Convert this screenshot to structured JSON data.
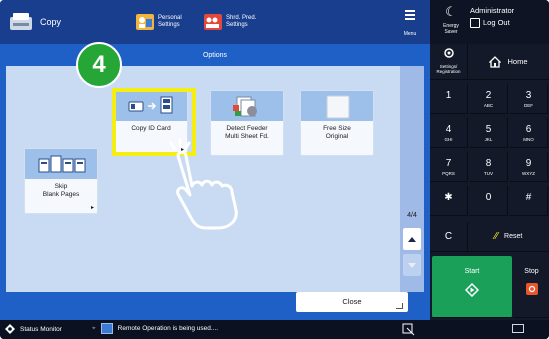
{
  "header": {
    "app_title": "Copy",
    "personal_settings": [
      "Personal",
      "Settings"
    ],
    "shared_settings": [
      "Shrd. Pred.",
      "Settings"
    ],
    "menu_label": "Menu",
    "energy_saver_label": "Energy Saver",
    "user_name": "Administrator",
    "logout_label": "Log Out"
  },
  "options_panel": {
    "title": "Options",
    "page_indicator": "4/4",
    "close_label": "Close",
    "items": [
      {
        "label": "Copy ID Card",
        "label2": "",
        "has_arrow": true,
        "icon": "id-card-copy-icon"
      },
      {
        "label": "Detect Feeder",
        "label2": "Multi Sheet Fd.",
        "has_arrow": false,
        "icon": "detect-feeder-icon"
      },
      {
        "label": "Free Size",
        "label2": "Original",
        "has_arrow": false,
        "icon": "free-size-original-icon"
      },
      {
        "label": "Skip",
        "label2": "Blank Pages",
        "has_arrow": true,
        "icon": "skip-blank-pages-icon"
      }
    ]
  },
  "tutorial": {
    "step_number": "4"
  },
  "keypad": {
    "settings_registration": [
      "Settings/",
      "Registration"
    ],
    "home_label": "Home",
    "keys": [
      {
        "num": "1",
        "sub": ""
      },
      {
        "num": "2",
        "sub": "ABC"
      },
      {
        "num": "3",
        "sub": "DEF"
      },
      {
        "num": "4",
        "sub": "GHI"
      },
      {
        "num": "5",
        "sub": "JKL"
      },
      {
        "num": "6",
        "sub": "MNO"
      },
      {
        "num": "7",
        "sub": "PQRS"
      },
      {
        "num": "8",
        "sub": "TUV"
      },
      {
        "num": "9",
        "sub": "WXYZ"
      },
      {
        "num": "✱",
        "sub": ""
      },
      {
        "num": "0",
        "sub": ""
      },
      {
        "num": "#",
        "sub": ""
      }
    ],
    "clear_label": "C",
    "reset_label": "Reset",
    "start_label": "Start",
    "stop_label": "Stop"
  },
  "status_bar": {
    "monitor_label": "Status Monitor",
    "message": "Remote Operation is being used...."
  },
  "colors": {
    "header_blue": "#1a3e8e",
    "panel_blue": "#1f60c6",
    "highlight_yellow": "#f5ee14",
    "badge_green": "#25a637",
    "start_green": "#1ba05a",
    "stop_red": "#e8572b"
  }
}
